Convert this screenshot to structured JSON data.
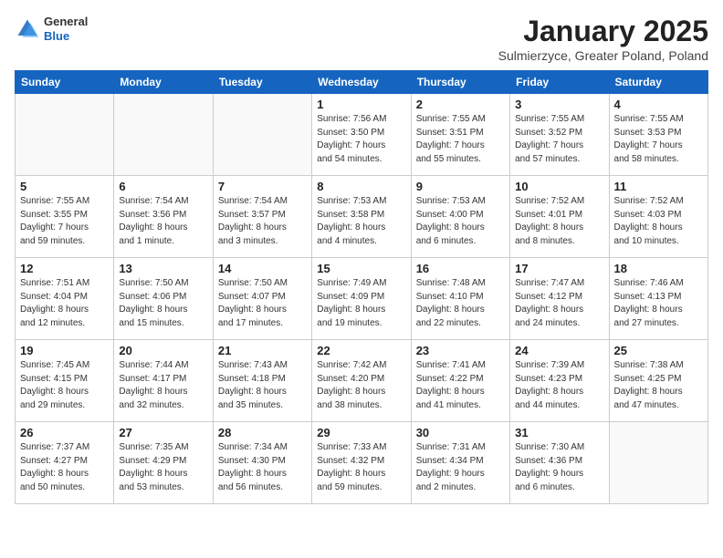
{
  "header": {
    "logo": {
      "general": "General",
      "blue": "Blue"
    },
    "title": "January 2025",
    "subtitle": "Sulmierzyce, Greater Poland, Poland"
  },
  "weekdays": [
    "Sunday",
    "Monday",
    "Tuesday",
    "Wednesday",
    "Thursday",
    "Friday",
    "Saturday"
  ],
  "weeks": [
    [
      {
        "day": "",
        "info": ""
      },
      {
        "day": "",
        "info": ""
      },
      {
        "day": "",
        "info": ""
      },
      {
        "day": "1",
        "info": "Sunrise: 7:56 AM\nSunset: 3:50 PM\nDaylight: 7 hours\nand 54 minutes."
      },
      {
        "day": "2",
        "info": "Sunrise: 7:55 AM\nSunset: 3:51 PM\nDaylight: 7 hours\nand 55 minutes."
      },
      {
        "day": "3",
        "info": "Sunrise: 7:55 AM\nSunset: 3:52 PM\nDaylight: 7 hours\nand 57 minutes."
      },
      {
        "day": "4",
        "info": "Sunrise: 7:55 AM\nSunset: 3:53 PM\nDaylight: 7 hours\nand 58 minutes."
      }
    ],
    [
      {
        "day": "5",
        "info": "Sunrise: 7:55 AM\nSunset: 3:55 PM\nDaylight: 7 hours\nand 59 minutes."
      },
      {
        "day": "6",
        "info": "Sunrise: 7:54 AM\nSunset: 3:56 PM\nDaylight: 8 hours\nand 1 minute."
      },
      {
        "day": "7",
        "info": "Sunrise: 7:54 AM\nSunset: 3:57 PM\nDaylight: 8 hours\nand 3 minutes."
      },
      {
        "day": "8",
        "info": "Sunrise: 7:53 AM\nSunset: 3:58 PM\nDaylight: 8 hours\nand 4 minutes."
      },
      {
        "day": "9",
        "info": "Sunrise: 7:53 AM\nSunset: 4:00 PM\nDaylight: 8 hours\nand 6 minutes."
      },
      {
        "day": "10",
        "info": "Sunrise: 7:52 AM\nSunset: 4:01 PM\nDaylight: 8 hours\nand 8 minutes."
      },
      {
        "day": "11",
        "info": "Sunrise: 7:52 AM\nSunset: 4:03 PM\nDaylight: 8 hours\nand 10 minutes."
      }
    ],
    [
      {
        "day": "12",
        "info": "Sunrise: 7:51 AM\nSunset: 4:04 PM\nDaylight: 8 hours\nand 12 minutes."
      },
      {
        "day": "13",
        "info": "Sunrise: 7:50 AM\nSunset: 4:06 PM\nDaylight: 8 hours\nand 15 minutes."
      },
      {
        "day": "14",
        "info": "Sunrise: 7:50 AM\nSunset: 4:07 PM\nDaylight: 8 hours\nand 17 minutes."
      },
      {
        "day": "15",
        "info": "Sunrise: 7:49 AM\nSunset: 4:09 PM\nDaylight: 8 hours\nand 19 minutes."
      },
      {
        "day": "16",
        "info": "Sunrise: 7:48 AM\nSunset: 4:10 PM\nDaylight: 8 hours\nand 22 minutes."
      },
      {
        "day": "17",
        "info": "Sunrise: 7:47 AM\nSunset: 4:12 PM\nDaylight: 8 hours\nand 24 minutes."
      },
      {
        "day": "18",
        "info": "Sunrise: 7:46 AM\nSunset: 4:13 PM\nDaylight: 8 hours\nand 27 minutes."
      }
    ],
    [
      {
        "day": "19",
        "info": "Sunrise: 7:45 AM\nSunset: 4:15 PM\nDaylight: 8 hours\nand 29 minutes."
      },
      {
        "day": "20",
        "info": "Sunrise: 7:44 AM\nSunset: 4:17 PM\nDaylight: 8 hours\nand 32 minutes."
      },
      {
        "day": "21",
        "info": "Sunrise: 7:43 AM\nSunset: 4:18 PM\nDaylight: 8 hours\nand 35 minutes."
      },
      {
        "day": "22",
        "info": "Sunrise: 7:42 AM\nSunset: 4:20 PM\nDaylight: 8 hours\nand 38 minutes."
      },
      {
        "day": "23",
        "info": "Sunrise: 7:41 AM\nSunset: 4:22 PM\nDaylight: 8 hours\nand 41 minutes."
      },
      {
        "day": "24",
        "info": "Sunrise: 7:39 AM\nSunset: 4:23 PM\nDaylight: 8 hours\nand 44 minutes."
      },
      {
        "day": "25",
        "info": "Sunrise: 7:38 AM\nSunset: 4:25 PM\nDaylight: 8 hours\nand 47 minutes."
      }
    ],
    [
      {
        "day": "26",
        "info": "Sunrise: 7:37 AM\nSunset: 4:27 PM\nDaylight: 8 hours\nand 50 minutes."
      },
      {
        "day": "27",
        "info": "Sunrise: 7:35 AM\nSunset: 4:29 PM\nDaylight: 8 hours\nand 53 minutes."
      },
      {
        "day": "28",
        "info": "Sunrise: 7:34 AM\nSunset: 4:30 PM\nDaylight: 8 hours\nand 56 minutes."
      },
      {
        "day": "29",
        "info": "Sunrise: 7:33 AM\nSunset: 4:32 PM\nDaylight: 8 hours\nand 59 minutes."
      },
      {
        "day": "30",
        "info": "Sunrise: 7:31 AM\nSunset: 4:34 PM\nDaylight: 9 hours\nand 2 minutes."
      },
      {
        "day": "31",
        "info": "Sunrise: 7:30 AM\nSunset: 4:36 PM\nDaylight: 9 hours\nand 6 minutes."
      },
      {
        "day": "",
        "info": ""
      }
    ]
  ]
}
